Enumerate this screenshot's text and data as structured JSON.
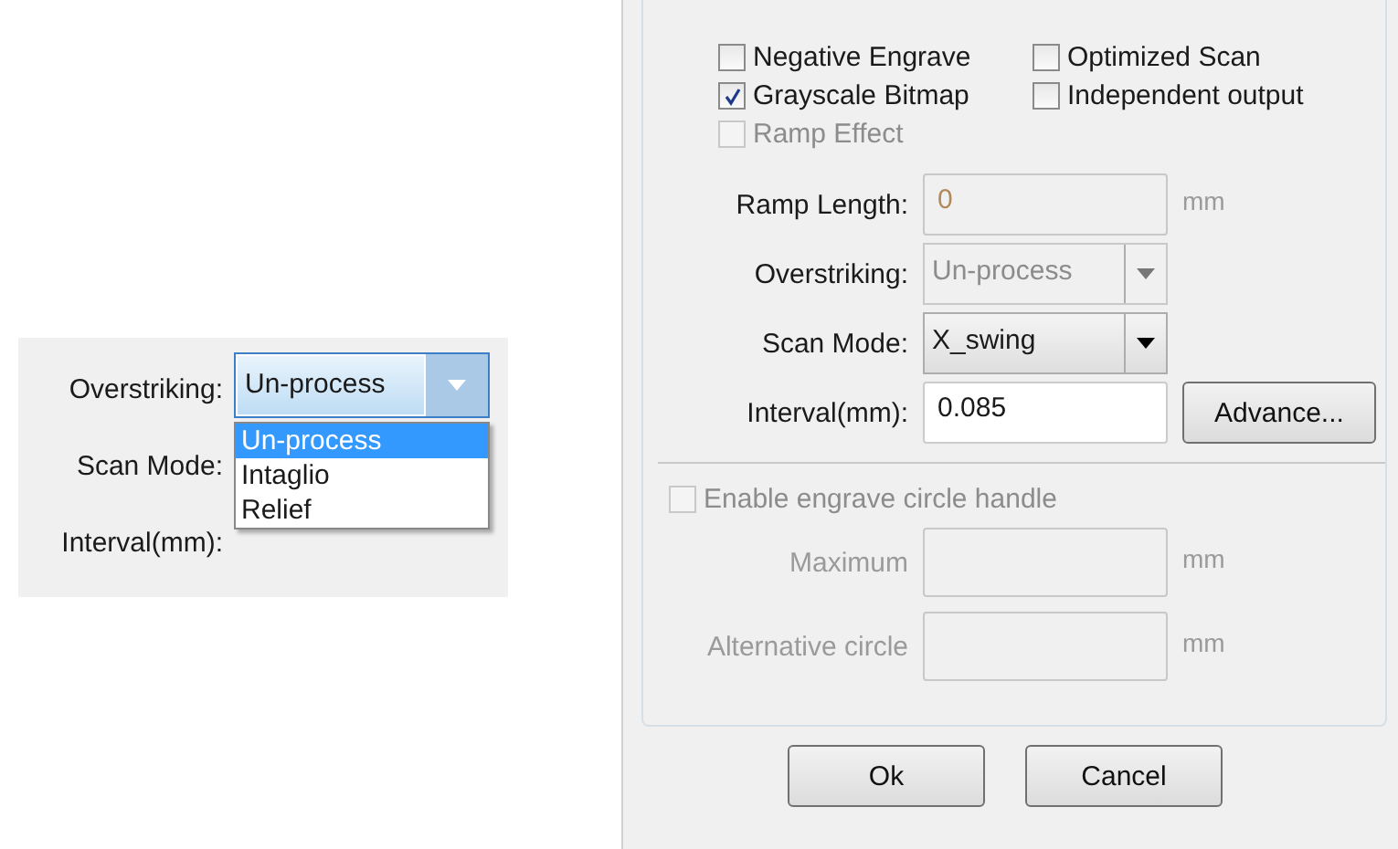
{
  "inset": {
    "labels": [
      "Overstriking:",
      "Scan Mode:",
      "Interval(mm):"
    ],
    "combo": {
      "value": "Un-process",
      "expanded": true
    },
    "options": [
      {
        "label": "Un-process",
        "selected": true
      },
      {
        "label": "Intaglio",
        "selected": false
      },
      {
        "label": "Relief",
        "selected": false
      }
    ]
  },
  "dialog": {
    "checkboxes": [
      {
        "label": "Negative Engrave",
        "checked": false,
        "disabled": false
      },
      {
        "label": "Optimized Scan",
        "checked": false,
        "disabled": false
      },
      {
        "label": "Grayscale Bitmap",
        "checked": true,
        "disabled": false
      },
      {
        "label": "Independent output",
        "checked": false,
        "disabled": false
      },
      {
        "label": "Ramp Effect",
        "checked": false,
        "disabled": true
      }
    ],
    "fields": [
      {
        "kind": "text",
        "label": "Ramp Length:",
        "value": "0",
        "unit": "mm",
        "disabled": true
      },
      {
        "kind": "combo",
        "label": "Overstriking:",
        "value": "Un-process",
        "disabled": true
      },
      {
        "kind": "combo",
        "label": "Scan Mode:",
        "value": "X_swing",
        "disabled": false
      },
      {
        "kind": "text",
        "label": "Interval(mm):",
        "value": "0.085",
        "disabled": false,
        "button": "Advance..."
      }
    ],
    "circle_handle": {
      "label": "Enable engrave circle handle",
      "checked": false,
      "disabled": true
    },
    "circle_fields": [
      {
        "kind": "text",
        "label": "Maximum",
        "unit": "mm",
        "disabled": true
      },
      {
        "kind": "text",
        "label": "Alternative circle",
        "unit": "mm",
        "disabled": true
      }
    ],
    "buttons": [
      "Ok",
      "Cancel"
    ]
  }
}
